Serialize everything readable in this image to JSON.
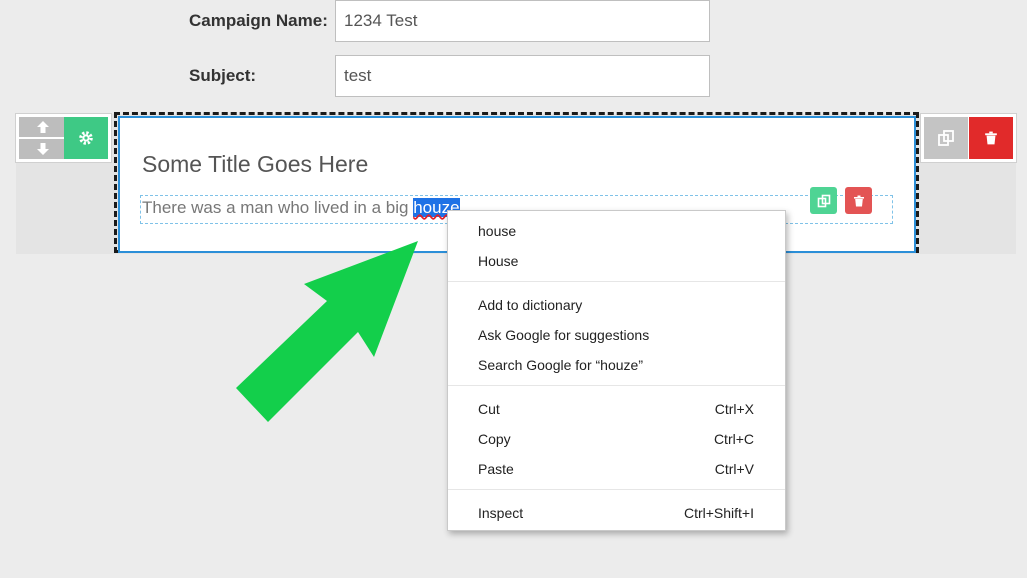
{
  "form": {
    "campaign_label": "Campaign Name:",
    "campaign_value": "1234 Test",
    "subject_label": "Subject:",
    "subject_value": "test"
  },
  "block": {
    "title": "Some Title Goes Here",
    "text_before": "There was a man who lived in a big ",
    "selected_word": "houze"
  },
  "icons": {
    "up": "arrow-up-icon",
    "down": "arrow-down-icon",
    "settings": "gear-icon",
    "duplicate": "copy-icon",
    "delete": "trash-icon"
  },
  "colors": {
    "accent_green": "#3ec985",
    "delete_red": "#e12a2a",
    "selection_blue": "#1e72e6",
    "pointer_arrow": "#13cf4b"
  },
  "context_menu": {
    "suggestions": [
      "house",
      "House"
    ],
    "spell_actions": [
      "Add to dictionary",
      "Ask Google for suggestions",
      "Search Google for “houze”"
    ],
    "edit_actions": [
      {
        "label": "Cut",
        "shortcut": "Ctrl+X"
      },
      {
        "label": "Copy",
        "shortcut": "Ctrl+C"
      },
      {
        "label": "Paste",
        "shortcut": "Ctrl+V"
      }
    ],
    "dev_actions": [
      {
        "label": "Inspect",
        "shortcut": "Ctrl+Shift+I"
      }
    ]
  }
}
